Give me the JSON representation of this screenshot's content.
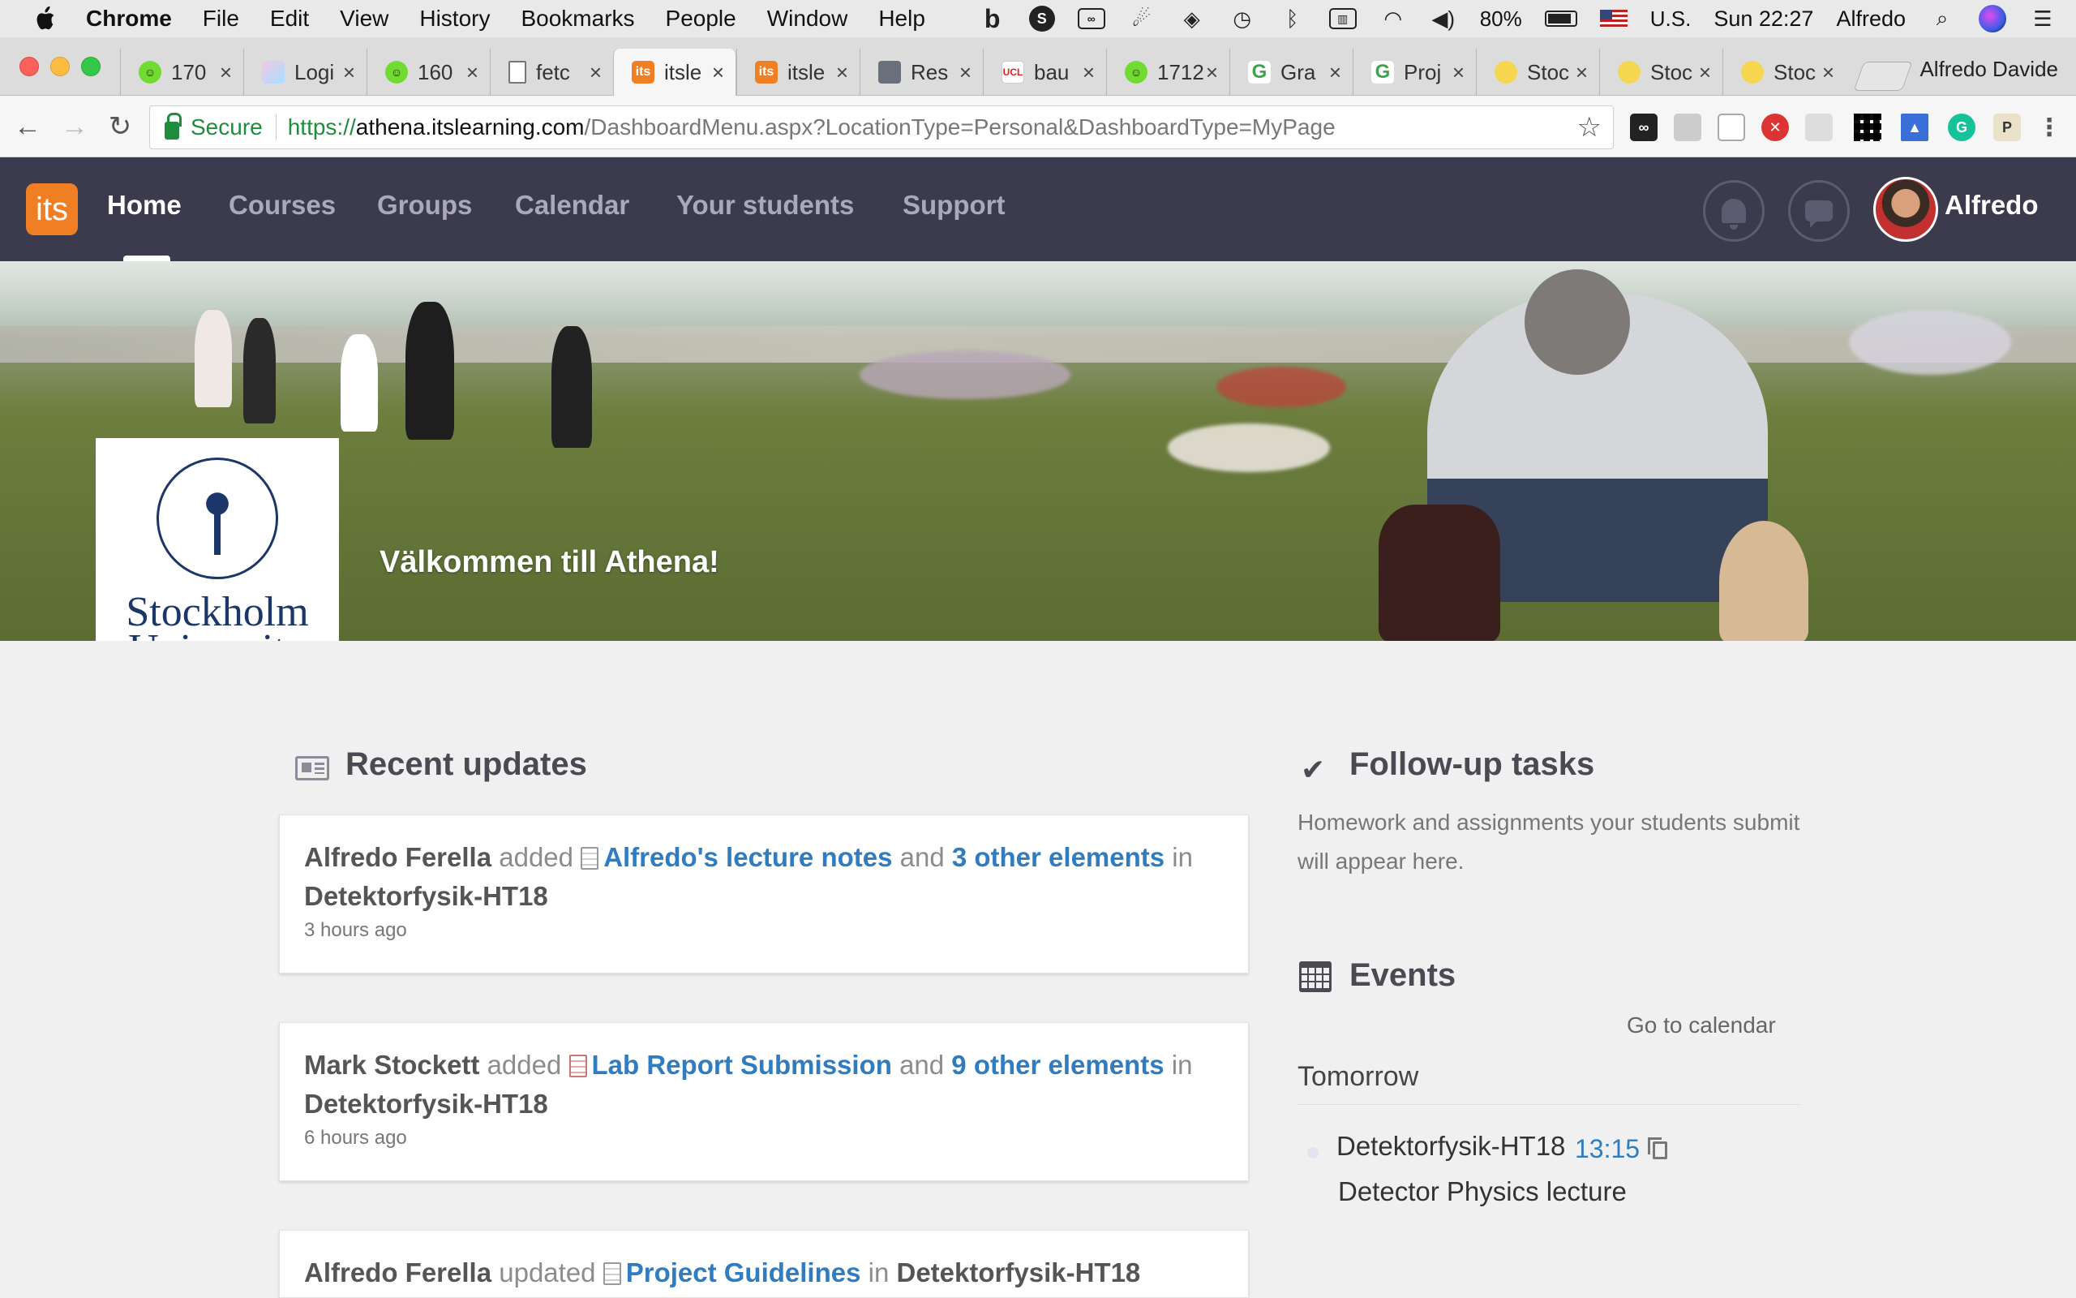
{
  "menubar": {
    "app": "Chrome",
    "items": [
      "File",
      "Edit",
      "View",
      "History",
      "Bookmarks",
      "People",
      "Window",
      "Help"
    ],
    "battery": "80%",
    "input_source": "U.S.",
    "clock": "Sun 22:27",
    "user": "Alfredo"
  },
  "tabs": [
    {
      "label": "170",
      "icon": "smiley-icon"
    },
    {
      "label": "Logi",
      "icon": "hand-icon"
    },
    {
      "label": "160",
      "icon": "smiley-icon"
    },
    {
      "label": "fetc",
      "icon": "page-icon"
    },
    {
      "label": "itsle",
      "icon": "its-icon"
    },
    {
      "label": "itsle",
      "icon": "its-icon"
    },
    {
      "label": "Res",
      "icon": "crest-icon"
    },
    {
      "label": "bau",
      "icon": "ucl-hep-icon"
    },
    {
      "label": "1712",
      "icon": "smiley-icon"
    },
    {
      "label": "Gra",
      "icon": "g-icon"
    },
    {
      "label": "Proj",
      "icon": "g-icon"
    },
    {
      "label": "Stoc",
      "icon": "su-icon"
    },
    {
      "label": "Stoc",
      "icon": "su-icon"
    },
    {
      "label": "Stoc",
      "icon": "su-icon"
    }
  ],
  "browser": {
    "profile": "Alfredo Davide",
    "secure_label": "Secure",
    "url_scheme": "https://",
    "url_host": "athena.itslearning.com",
    "url_path": "/DashboardMenu.aspx?LocationType=Personal&DashboardType=MyPage"
  },
  "appnav": {
    "logo": "its",
    "items": [
      "Home",
      "Courses",
      "Groups",
      "Calendar",
      "Your students",
      "Support"
    ],
    "user": "Alfredo"
  },
  "banner": {
    "welcome": "Välkommen till Athena!",
    "logo_line1": "Stockholm",
    "logo_line2": "University"
  },
  "recent": {
    "title": "Recent updates",
    "items": [
      {
        "who": "Alfredo Ferella",
        "verb": "added",
        "link": "Alfredo's lecture notes",
        "and": "and",
        "others": "3 other elements",
        "in": "in",
        "course": "Detektorfysik-HT18",
        "when": "3 hours ago"
      },
      {
        "who": "Mark Stockett",
        "verb": "added",
        "link": "Lab Report Submission",
        "and": "and",
        "others": "9 other elements",
        "in": "in",
        "course": "Detektorfysik-HT18",
        "when": "6 hours ago"
      },
      {
        "who": "Alfredo Ferella",
        "verb": "updated",
        "link": "Project Guidelines",
        "in": "in",
        "course": "Detektorfysik-HT18"
      }
    ]
  },
  "followup": {
    "title": "Follow-up tasks",
    "desc": "Homework and assignments your students submit will appear here."
  },
  "events": {
    "title": "Events",
    "goto": "Go to calendar",
    "day": "Tomorrow",
    "course": "Detektorfysik-HT18",
    "time": "13:15",
    "event_title": "Detector Physics lecture"
  }
}
